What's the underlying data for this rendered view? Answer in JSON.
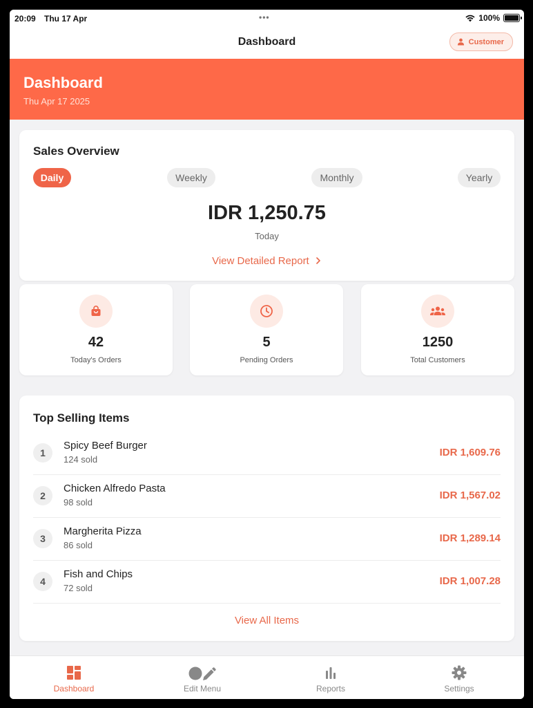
{
  "status_bar": {
    "time": "20:09",
    "date": "Thu 17 Apr",
    "battery": "100%"
  },
  "nav": {
    "title": "Dashboard",
    "role_label": "Customer"
  },
  "header": {
    "title": "Dashboard",
    "date": "Thu Apr 17 2025"
  },
  "sales_overview": {
    "title": "Sales Overview",
    "periods": [
      "Daily",
      "Weekly",
      "Monthly",
      "Yearly"
    ],
    "selected_period": "Daily",
    "amount": "IDR 1,250.75",
    "caption": "Today",
    "report_link": "View Detailed Report"
  },
  "stats": [
    {
      "value": "42",
      "label": "Today's Orders",
      "icon": "shopping-bag-icon"
    },
    {
      "value": "5",
      "label": "Pending Orders",
      "icon": "clock-icon"
    },
    {
      "value": "1250",
      "label": "Total Customers",
      "icon": "people-icon"
    }
  ],
  "top_selling": {
    "title": "Top Selling Items",
    "items": [
      {
        "rank": "1",
        "name": "Spicy Beef Burger",
        "sold": "124 sold",
        "revenue": "IDR 1,609.76"
      },
      {
        "rank": "2",
        "name": "Chicken Alfredo Pasta",
        "sold": "98 sold",
        "revenue": "IDR 1,567.02"
      },
      {
        "rank": "3",
        "name": "Margherita Pizza",
        "sold": "86 sold",
        "revenue": "IDR 1,289.14"
      },
      {
        "rank": "4",
        "name": "Fish and Chips",
        "sold": "72 sold",
        "revenue": "IDR 1,007.28"
      }
    ],
    "view_all": "View All Items"
  },
  "tabs": [
    {
      "label": "Dashboard",
      "icon": "dashboard-grid-icon",
      "active": true
    },
    {
      "label": "Edit Menu",
      "icon": "edit-pencil-icon",
      "active": false
    },
    {
      "label": "Reports",
      "icon": "bar-chart-icon",
      "active": false
    },
    {
      "label": "Settings",
      "icon": "gear-icon",
      "active": false
    }
  ],
  "colors": {
    "accent": "#fe6948",
    "accent_text": "#e8684a",
    "background": "#f2f2f4"
  }
}
